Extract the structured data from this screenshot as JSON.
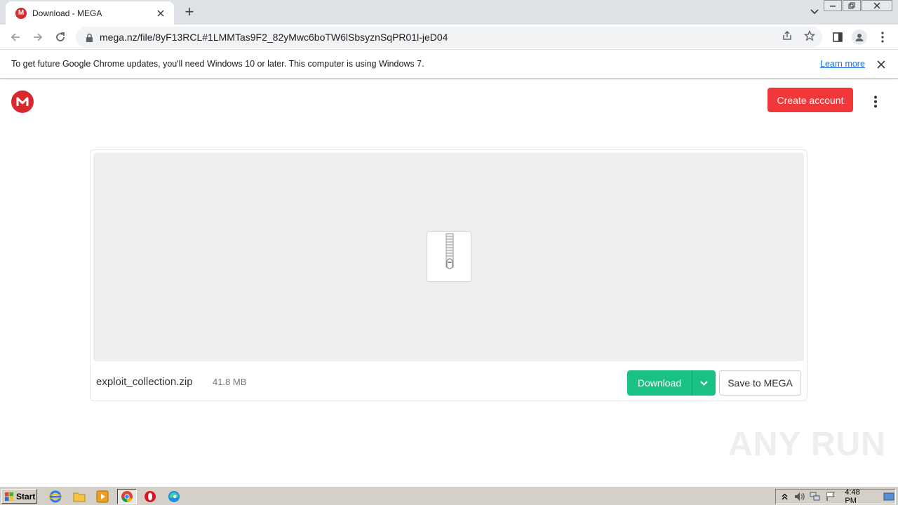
{
  "browser": {
    "tab_title": "Download - MEGA",
    "tab_favicon_letter": "M",
    "new_tab_symbol": "+",
    "url": "mega.nz/file/8yF13RCL#1LMMTas9F2_82yMwc6boTW6lSbsyznSqPR01l-jeD04"
  },
  "infobar": {
    "message": "To get future Google Chrome updates, you'll need Windows 10 or later. This computer is using Windows 7.",
    "link": "Learn more"
  },
  "page": {
    "create_account": "Create account",
    "file_name": "exploit_collection.zip",
    "file_size": "41.8 MB",
    "download_label": "Download",
    "save_label": "Save to MEGA",
    "brand_color": "#d9272e",
    "download_color": "#1ac185"
  },
  "watermark": "ANY RUN",
  "taskbar": {
    "start_label": "Start",
    "clock": "4:48 PM"
  }
}
